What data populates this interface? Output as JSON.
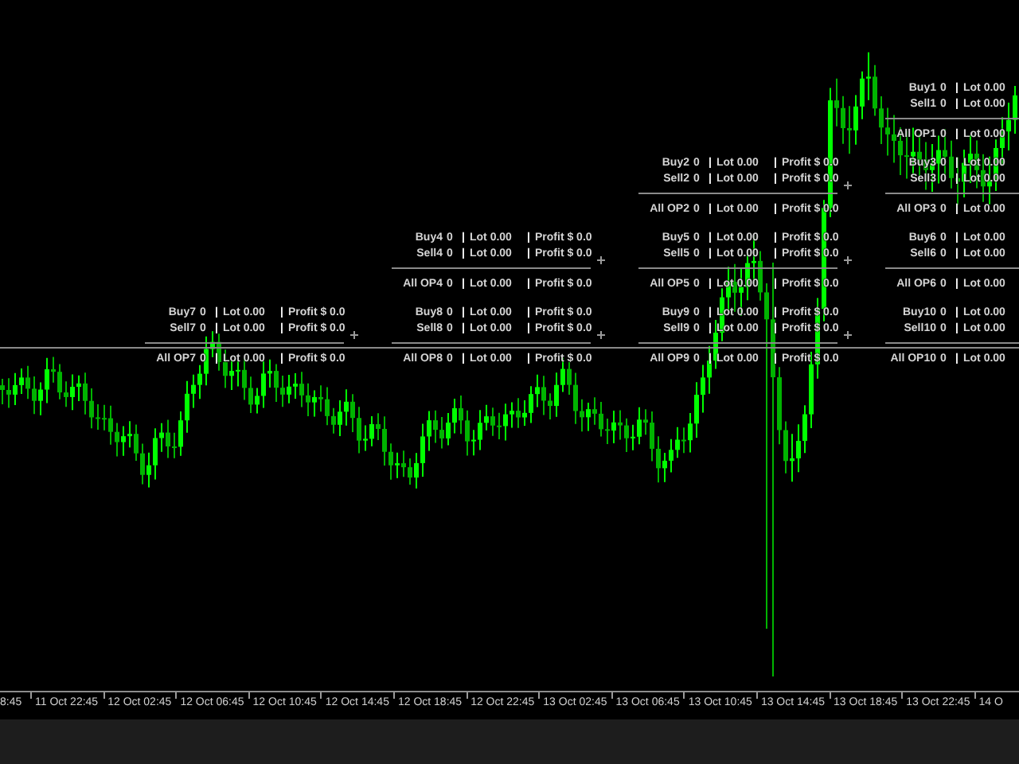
{
  "separator": "|",
  "panels": [
    {
      "rows": [
        {
          "kind": "buy",
          "label": "Buy1",
          "count": "0",
          "lot": "Lot 0.00"
        },
        {
          "kind": "sell",
          "label": "Sell1",
          "count": "0",
          "lot": "Lot 0.00"
        },
        {
          "kind": "total",
          "label": "All OP1",
          "count": "0",
          "lot": "Lot 0.00"
        }
      ]
    },
    {
      "rows": [
        {
          "kind": "buy",
          "label": "Buy2",
          "count": "0",
          "lot": "Lot 0.00",
          "profit": "Profit $ 0.0"
        },
        {
          "kind": "sell",
          "label": "Sell2",
          "count": "0",
          "lot": "Lot 0.00",
          "profit": "Profit $ 0.0"
        },
        {
          "kind": "total",
          "label": "All OP2",
          "count": "0",
          "lot": "Lot 0.00",
          "profit": "Profit $ 0.0"
        }
      ]
    },
    {
      "rows": [
        {
          "kind": "buy",
          "label": "Buy3",
          "count": "0",
          "lot": "Lot 0.00"
        },
        {
          "kind": "sell",
          "label": "Sell3",
          "count": "0",
          "lot": "Lot 0.00"
        },
        {
          "kind": "total",
          "label": "All OP3",
          "count": "0",
          "lot": "Lot 0.00"
        }
      ]
    },
    {
      "rows": [
        {
          "kind": "buy",
          "label": "Buy4",
          "count": "0",
          "lot": "Lot 0.00",
          "profit": "Profit $ 0.0"
        },
        {
          "kind": "sell",
          "label": "Sell4",
          "count": "0",
          "lot": "Lot 0.00",
          "profit": "Profit $ 0.0"
        },
        {
          "kind": "total",
          "label": "All OP4",
          "count": "0",
          "lot": "Lot 0.00",
          "profit": "Profit $ 0.0"
        }
      ]
    },
    {
      "rows": [
        {
          "kind": "buy",
          "label": "Buy5",
          "count": "0",
          "lot": "Lot 0.00",
          "profit": "Profit $ 0.0"
        },
        {
          "kind": "sell",
          "label": "Sell5",
          "count": "0",
          "lot": "Lot 0.00",
          "profit": "Profit $ 0.0"
        },
        {
          "kind": "total",
          "label": "All OP5",
          "count": "0",
          "lot": "Lot 0.00",
          "profit": "Profit $ 0.0"
        }
      ]
    },
    {
      "rows": [
        {
          "kind": "buy",
          "label": "Buy6",
          "count": "0",
          "lot": "Lot 0.00"
        },
        {
          "kind": "sell",
          "label": "Sell6",
          "count": "0",
          "lot": "Lot 0.00"
        },
        {
          "kind": "total",
          "label": "All OP6",
          "count": "0",
          "lot": "Lot 0.00"
        }
      ]
    },
    {
      "rows": [
        {
          "kind": "buy",
          "label": "Buy7",
          "count": "0",
          "lot": "Lot 0.00",
          "profit": "Profit $ 0.0"
        },
        {
          "kind": "sell",
          "label": "Sell7",
          "count": "0",
          "lot": "Lot 0.00",
          "profit": "Profit $ 0.0"
        },
        {
          "kind": "total",
          "label": "All OP7",
          "count": "0",
          "lot": "Lot 0.00",
          "profit": "Profit $ 0.0"
        }
      ]
    },
    {
      "rows": [
        {
          "kind": "buy",
          "label": "Buy8",
          "count": "0",
          "lot": "Lot 0.00",
          "profit": "Profit $ 0.0"
        },
        {
          "kind": "sell",
          "label": "Sell8",
          "count": "0",
          "lot": "Lot 0.00",
          "profit": "Profit $ 0.0"
        },
        {
          "kind": "total",
          "label": "All OP8",
          "count": "0",
          "lot": "Lot 0.00",
          "profit": "Profit $ 0.0"
        }
      ]
    },
    {
      "rows": [
        {
          "kind": "buy",
          "label": "Buy9",
          "count": "0",
          "lot": "Lot 0.00",
          "profit": "Profit $ 0.0"
        },
        {
          "kind": "sell",
          "label": "Sell9",
          "count": "0",
          "lot": "Lot 0.00",
          "profit": "Profit $ 0.0"
        },
        {
          "kind": "total",
          "label": "All OP9",
          "count": "0",
          "lot": "Lot 0.00",
          "profit": "Profit $ 0.0"
        }
      ]
    },
    {
      "rows": [
        {
          "kind": "buy",
          "label": "Buy10",
          "count": "0",
          "lot": "Lot 0.00"
        },
        {
          "kind": "sell",
          "label": "Sell10",
          "count": "0",
          "lot": "Lot 0.00"
        },
        {
          "kind": "total",
          "label": "All OP10",
          "count": "0",
          "lot": "Lot 0.00"
        }
      ]
    }
  ],
  "time_axis": {
    "labels": [
      "8:45",
      "11 Oct 22:45",
      "12 Oct 02:45",
      "12 Oct 06:45",
      "12 Oct 10:45",
      "12 Oct 14:45",
      "12 Oct 18:45",
      "12 Oct 22:45",
      "13 Oct 02:45",
      "13 Oct 06:45",
      "13 Oct 10:45",
      "13 Oct 14:45",
      "13 Oct 18:45",
      "13 Oct 22:45",
      "14 O"
    ]
  }
}
